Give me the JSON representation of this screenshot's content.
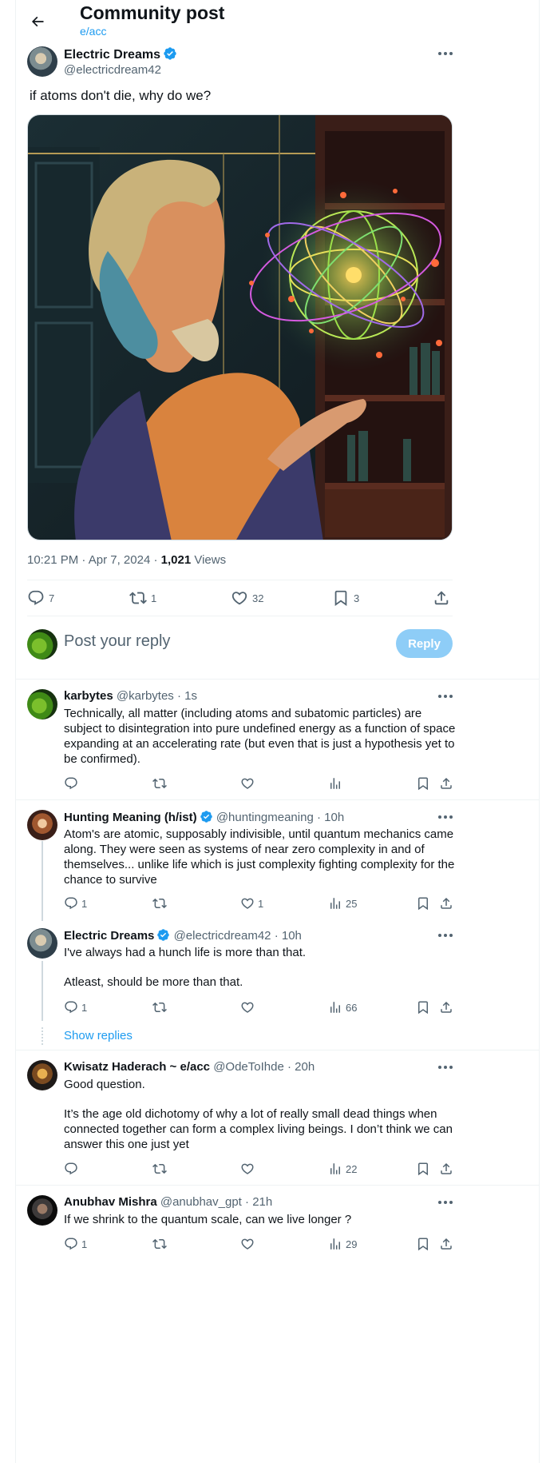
{
  "header": {
    "title": "Community post",
    "community": "e/acc"
  },
  "post": {
    "author_name": "Electric Dreams",
    "author_handle": "@electricdream42",
    "text": "if atoms don't die, why do we?",
    "time": "10:21 PM",
    "date": "Apr 7, 2024",
    "views_count": "1,021",
    "views_label": "Views",
    "replies": "7",
    "reposts": "1",
    "likes": "32",
    "bookmarks": "3"
  },
  "compose": {
    "placeholder": "Post your reply",
    "button_label": "Reply"
  },
  "replies": [
    {
      "name": "karbytes",
      "handle": "@karbytes",
      "time": "1s",
      "verified": false,
      "paragraphs": [
        "Technically, all matter (including atoms and subatomic particles) are subject to disintegration into pure undefined energy as a function of space expanding at an accelerating rate (but even that is just a hypothesis yet to be confirmed)."
      ],
      "replies": "",
      "reposts": "",
      "likes": "",
      "views": ""
    },
    {
      "name": "Hunting Meaning (h/ist)",
      "handle": "@huntingmeaning",
      "time": "10h",
      "verified": true,
      "paragraphs": [
        "Atom's are atomic, supposably indivisible, until quantum mechanics came along. They were seen as systems of near zero complexity in and of themselves... unlike life which is just complexity fighting complexity for the chance to survive"
      ],
      "replies": "1",
      "reposts": "",
      "likes": "1",
      "views": "25"
    },
    {
      "name": "Electric Dreams",
      "handle": "@electricdream42",
      "time": "10h",
      "verified": true,
      "paragraphs": [
        "I've always had a hunch life is more than that.",
        "Atleast, should be more than that."
      ],
      "replies": "1",
      "reposts": "",
      "likes": "",
      "views": "66"
    },
    {
      "name": "Kwisatz Haderach ~ e/acc",
      "handle": "@OdeToIhde",
      "time": "20h",
      "verified": false,
      "paragraphs": [
        "Good question.",
        "It’s the age old dichotomy of why a lot of really small dead things when connected together can form a complex living beings. I don’t think we can answer this one just yet"
      ],
      "replies": "",
      "reposts": "",
      "likes": "",
      "views": "22"
    },
    {
      "name": "Anubhav Mishra",
      "handle": "@anubhav_gpt",
      "time": "21h",
      "verified": false,
      "paragraphs": [
        "If we shrink to the quantum scale, can we live longer ?"
      ],
      "replies": "1",
      "reposts": "",
      "likes": "",
      "views": "29"
    }
  ],
  "show_replies_label": "Show replies",
  "colors": {
    "accent": "#1d9bf0",
    "secondary_text": "#536471",
    "border": "#eff3f4"
  },
  "icons": [
    "back-arrow-icon",
    "verified-badge-icon",
    "more-icon",
    "reply-icon",
    "repost-icon",
    "like-icon",
    "views-icon",
    "bookmark-icon",
    "share-icon"
  ]
}
